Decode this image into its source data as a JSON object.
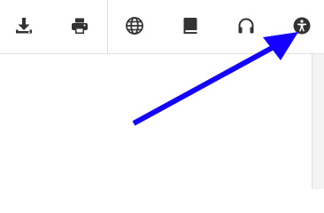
{
  "toolbar": {
    "buttons": [
      {
        "icon": "download-icon"
      },
      {
        "icon": "print-icon"
      },
      {
        "icon": "globe-icon"
      },
      {
        "icon": "book-icon"
      },
      {
        "icon": "headphones-icon"
      },
      {
        "icon": "accessibility-icon"
      }
    ],
    "icon_color": "#333333"
  },
  "annotation": {
    "type": "arrow",
    "color": "#1400ff",
    "points_to": "accessibility-button"
  }
}
